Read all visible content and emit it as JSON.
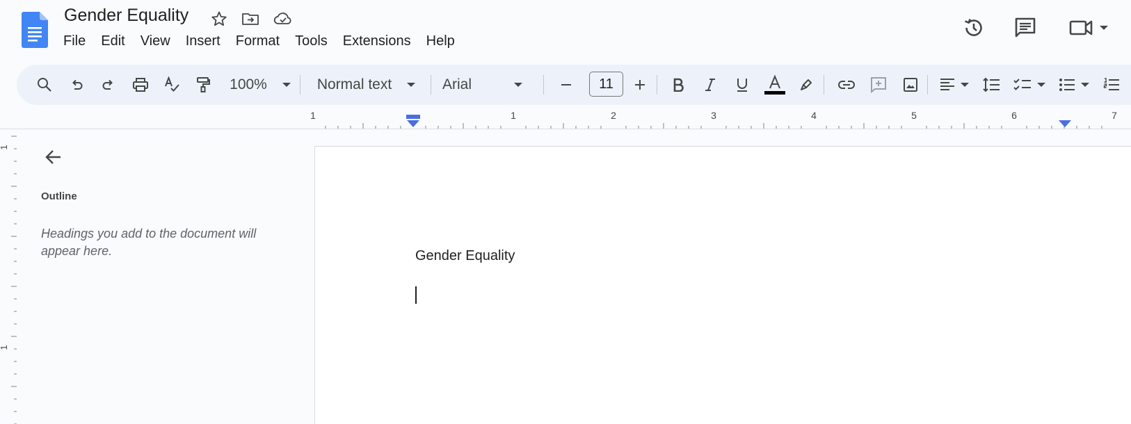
{
  "document": {
    "title": "Gender Equality",
    "body_text": "Gender Equality"
  },
  "menu": [
    "File",
    "Edit",
    "View",
    "Insert",
    "Format",
    "Tools",
    "Extensions",
    "Help"
  ],
  "toolbar": {
    "zoom": "100%",
    "style": "Normal text",
    "font": "Arial",
    "font_size": "11",
    "text_color": "#000000"
  },
  "ruler": {
    "labels": [
      "1",
      "1",
      "2",
      "3",
      "4",
      "5",
      "6",
      "7"
    ],
    "vertical_labels": [
      "1",
      "1"
    ]
  },
  "outline": {
    "title": "Outline",
    "hint": "Headings you add to the document will appear here."
  },
  "colors": {
    "accent": "#4285f4",
    "toolbar_bg": "#edf2fa",
    "page_bg": "#ffffff",
    "app_bg": "#f9fbfd",
    "icon": "#444746"
  },
  "icons": [
    "docs-logo-icon",
    "star-icon",
    "move-to-folder-icon",
    "cloud-saved-icon",
    "version-history-icon",
    "comments-icon",
    "meet-icon",
    "search-icon",
    "undo-icon",
    "redo-icon",
    "print-icon",
    "spellcheck-icon",
    "paint-format-icon",
    "decrease-font-icon",
    "increase-font-icon",
    "bold-icon",
    "italic-icon",
    "underline-icon",
    "text-color-icon",
    "highlight-icon",
    "link-icon",
    "add-comment-icon",
    "insert-image-icon",
    "align-left-icon",
    "line-spacing-icon",
    "checklist-icon",
    "bulleted-list-icon",
    "numbered-list-icon",
    "back-arrow-icon"
  ]
}
